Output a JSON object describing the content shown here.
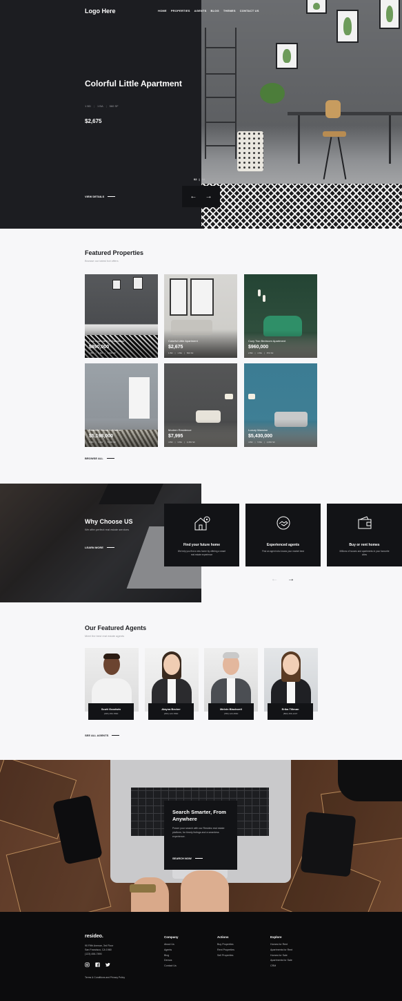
{
  "header": {
    "logo": "Logo Here",
    "nav": [
      "HOME",
      "PROPERTIES",
      "AGENTS",
      "BLOG",
      "THEMES",
      "CONTACT US"
    ]
  },
  "hero": {
    "title": "Colorful Little Apartment",
    "specs": [
      "1 BD",
      "1 BA",
      "560 SF"
    ],
    "price": "$2,675",
    "view_details": "VIEW DETAILS",
    "slide_current": "02",
    "slide_total": "04",
    "arrow_prev": "←",
    "arrow_next": "→"
  },
  "featured": {
    "title": "Featured Properties",
    "subtitle": "Browse our latest hot offers",
    "browse_all": "BROWSE ALL",
    "cards": [
      {
        "name": "Chic Apartment in Downtown",
        "price": "$890,000",
        "specs": [
          "4 BD",
          "2 BA",
          "2,540 SF"
        ]
      },
      {
        "name": "Colorful Little Apartment",
        "price": "$2,675",
        "specs": [
          "1 BD",
          "1 BA",
          "560 SF"
        ]
      },
      {
        "name": "Cozy Two Bedroom Apartment",
        "price": "$960,000",
        "specs": [
          "2 BD",
          "2 BA",
          "870 SF"
        ]
      },
      {
        "name": "Beautiful House in Marina",
        "price": "$5,198,000",
        "specs": [
          "5 BD",
          "4 BA",
          "5,200 SF"
        ]
      },
      {
        "name": "Modern Residence",
        "price": "$7,995",
        "specs": [
          "4 BD",
          "3 BA",
          "3,450 SF"
        ]
      },
      {
        "name": "Luxury Mansion",
        "price": "$5,430,000",
        "specs": [
          "4 BD",
          "5 BA",
          "4,800 SF"
        ]
      }
    ]
  },
  "why": {
    "title": "Why Choose US",
    "subtitle": "We offer perfect real estate services",
    "learn_more": "LEARN MORE",
    "features": [
      {
        "title": "Find your future home",
        "desc": "We help you find a new home by offering a smart real estate experience"
      },
      {
        "title": "Experienced agents",
        "desc": "Find an agent who knows your market best"
      },
      {
        "title": "Buy or rent homes",
        "desc": "Millions of houses and apartments in your favourite cities"
      }
    ],
    "arrow_prev": "←",
    "arrow_next": "→"
  },
  "agents": {
    "title": "Our Featured Agents",
    "subtitle": "Meet the best real estate agents",
    "see_all": "SEE ALL AGENTS",
    "list": [
      {
        "name": "Scott Goodwin",
        "phone": "(335) 456-7890"
      },
      {
        "name": "Alayna Becker",
        "phone": "(456) 123-7890"
      },
      {
        "name": "Melvin Blackwell",
        "phone": "(789) 123-4560"
      },
      {
        "name": "Erika Tillman",
        "phone": "(890) 456-1237"
      }
    ]
  },
  "search": {
    "title": "Search Smarter, From Anywhere",
    "desc": "Power your search with our Resideo real estate platform, for timely listings and a seamless experience.",
    "cta": "SEARCH NOW"
  },
  "footer": {
    "logo": "resideo.",
    "address": [
      "90 Fifth Avenue, 3rd Floor",
      "San Francisco, CA 1980",
      "(123) 456-7890"
    ],
    "terms": "Terms & Conditions and Privacy Policy",
    "columns": [
      {
        "heading": "Company",
        "items": [
          "About Us",
          "Agents",
          "Blog",
          "Demos",
          "Contact Us"
        ]
      },
      {
        "heading": "Actions",
        "items": [
          "Buy Properties",
          "Rent Properties",
          "Sell Properties"
        ]
      },
      {
        "heading": "Explore",
        "items": [
          "Homes for Rent",
          "Apartments for Rent",
          "Homes for Sale",
          "Apartments for Sale",
          "CRM"
        ]
      }
    ]
  },
  "colors": {
    "dark": "#1c1d21",
    "card": "#121316",
    "muted": "#9a9ba0",
    "background": "#f7f7f9"
  }
}
